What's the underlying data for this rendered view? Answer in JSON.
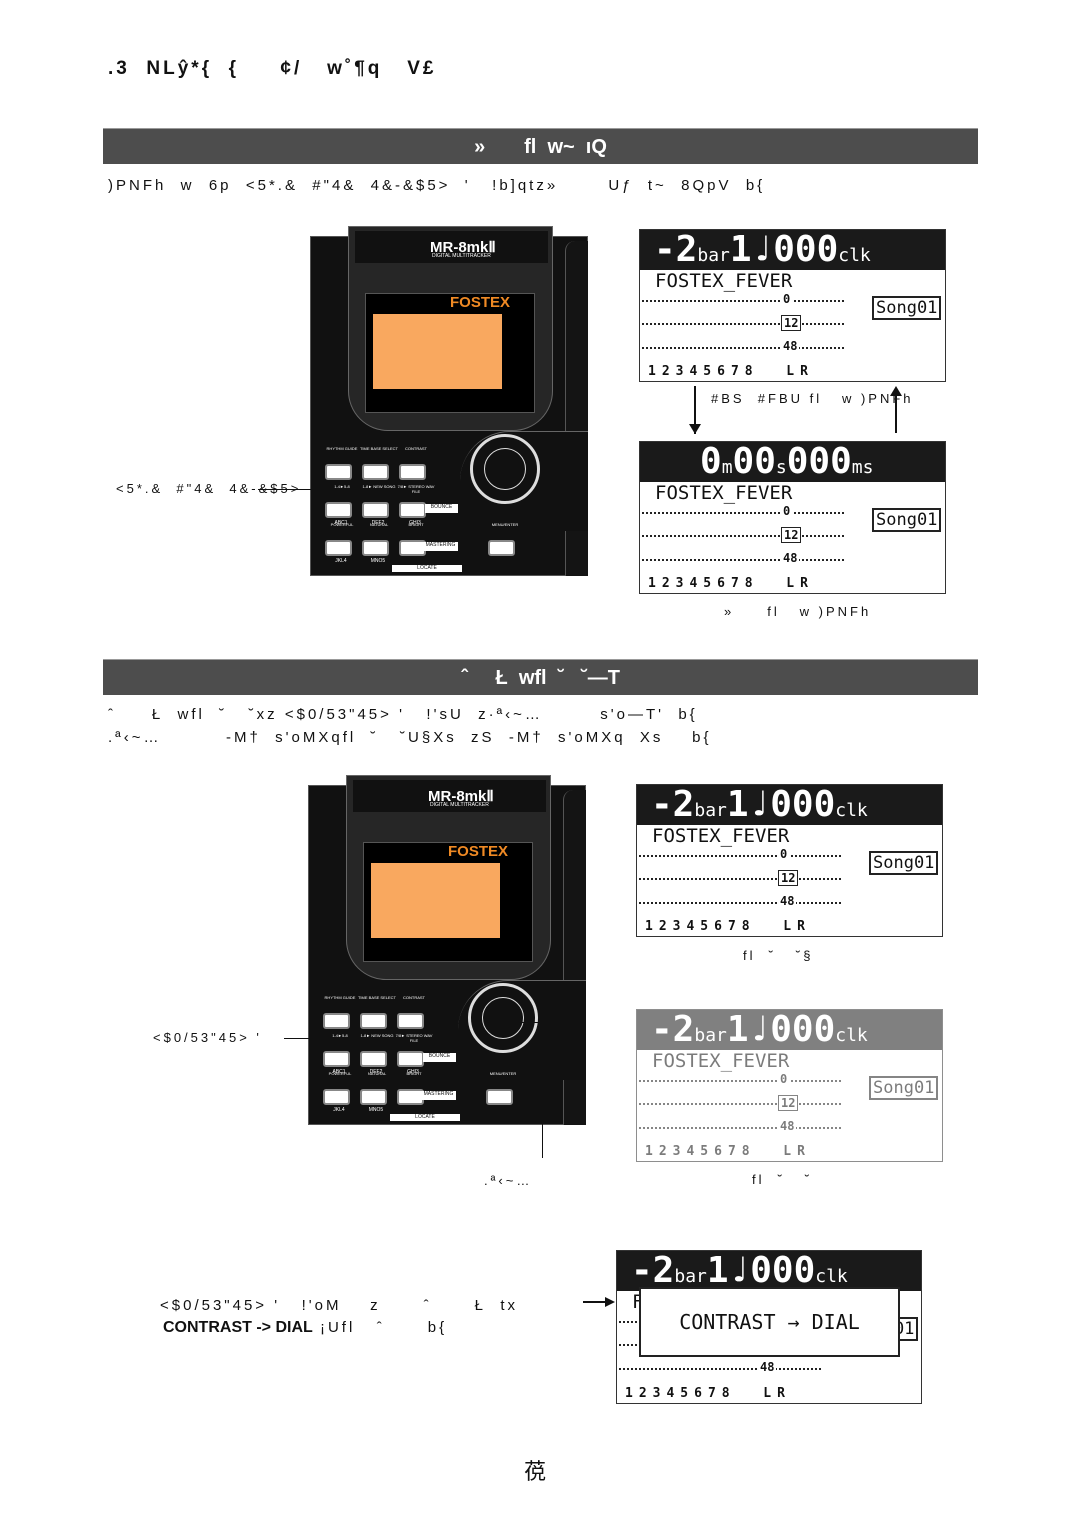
{
  "page_title": ".3  NLŷ*{  {     ¢/   w˚¶q   V£",
  "section1": {
    "heading": "»       fl  w~  ıQ",
    "body": ")PNFh  w  6p  <5*.&  #\"4&  4&-&$5>  '   !b]qtz»       Uƒ  t~  8QpV  b{",
    "device_caption": "<5*.&  #\"4&  4&-&$5>",
    "arrow_label": "#BS  #FBU fl   w )PNFh",
    "lcd2_caption": "»     fl   w )PNFh"
  },
  "section2": {
    "heading": "ˆ     Ł  wfl  ˘   ˘—T",
    "body_line1": "ˆ     Ł  wfl  ˘   ˘xz <$0/53\"45> '   !'sU  z·ª‹~…        s'o—T'  b{",
    "body_line2": ".ª‹~…         -M†  s'oMXqfl  ˘   ˘U§Xs  zS  -M†  s'oMXq  Xs    b{",
    "device_caption": "<$0/53\"45> '",
    "dial_caption": ".ª‹~…",
    "lcd3_caption": "fl  ˘   ˘§",
    "lcd4_caption": "fl  ˘   ˘"
  },
  "section3": {
    "text_line1": "<$0/53\"45> '   !'oM    z      ˆ      Ł  tx",
    "text_line2_bold": "CONTRAST -> DIAL",
    "text_line2_rest": " ¡Ufl   ˆ      b{",
    "popup": "CONTRAST → DIAL"
  },
  "page_number": "䓲",
  "lcd": {
    "bar_main": "-2",
    "bar_unit": "bar",
    "beat": "1♩000",
    "clk_unit": "clk",
    "time_m": "0",
    "m_unit": "m",
    "time_s": "00",
    "s_unit": "s",
    "time_ms": "000",
    "ms_unit": "ms",
    "song_name": "FOSTEX_FEVER",
    "song_id": "Song01",
    "meter_0": "0",
    "meter_12": "12",
    "meter_48": "48",
    "tracks": "12345678  LR"
  },
  "device": {
    "model": "MR-8mkⅡ",
    "subtitle": "DIGITAL MULTITRACKER",
    "brand": "FOSTEX",
    "buttons_row1": [
      "RHYTHM GUIDE",
      "TIME BASE SELECT",
      "CONTRAST"
    ],
    "buttons_row2": [
      "1-4►5-8",
      "1-8► NEW SONG",
      "7/8► STEREO WAV FILE"
    ],
    "bounce": "BOUNCE",
    "row2_sub": [
      "ABC1",
      "DEF2",
      "GHI3"
    ],
    "buttons_row3": [
      "POWERFUL",
      "NATURAL",
      "BRIGHT"
    ],
    "mastering": "MASTERING",
    "menu": "MENU/ENTER",
    "row3_sub": [
      "JKL4",
      "MNO5"
    ],
    "locate": "LOCATE"
  },
  "colors": {
    "section_bar": "#4d4d4d",
    "lcd_screen": "#f9a85f",
    "brand": "#f08a24"
  }
}
